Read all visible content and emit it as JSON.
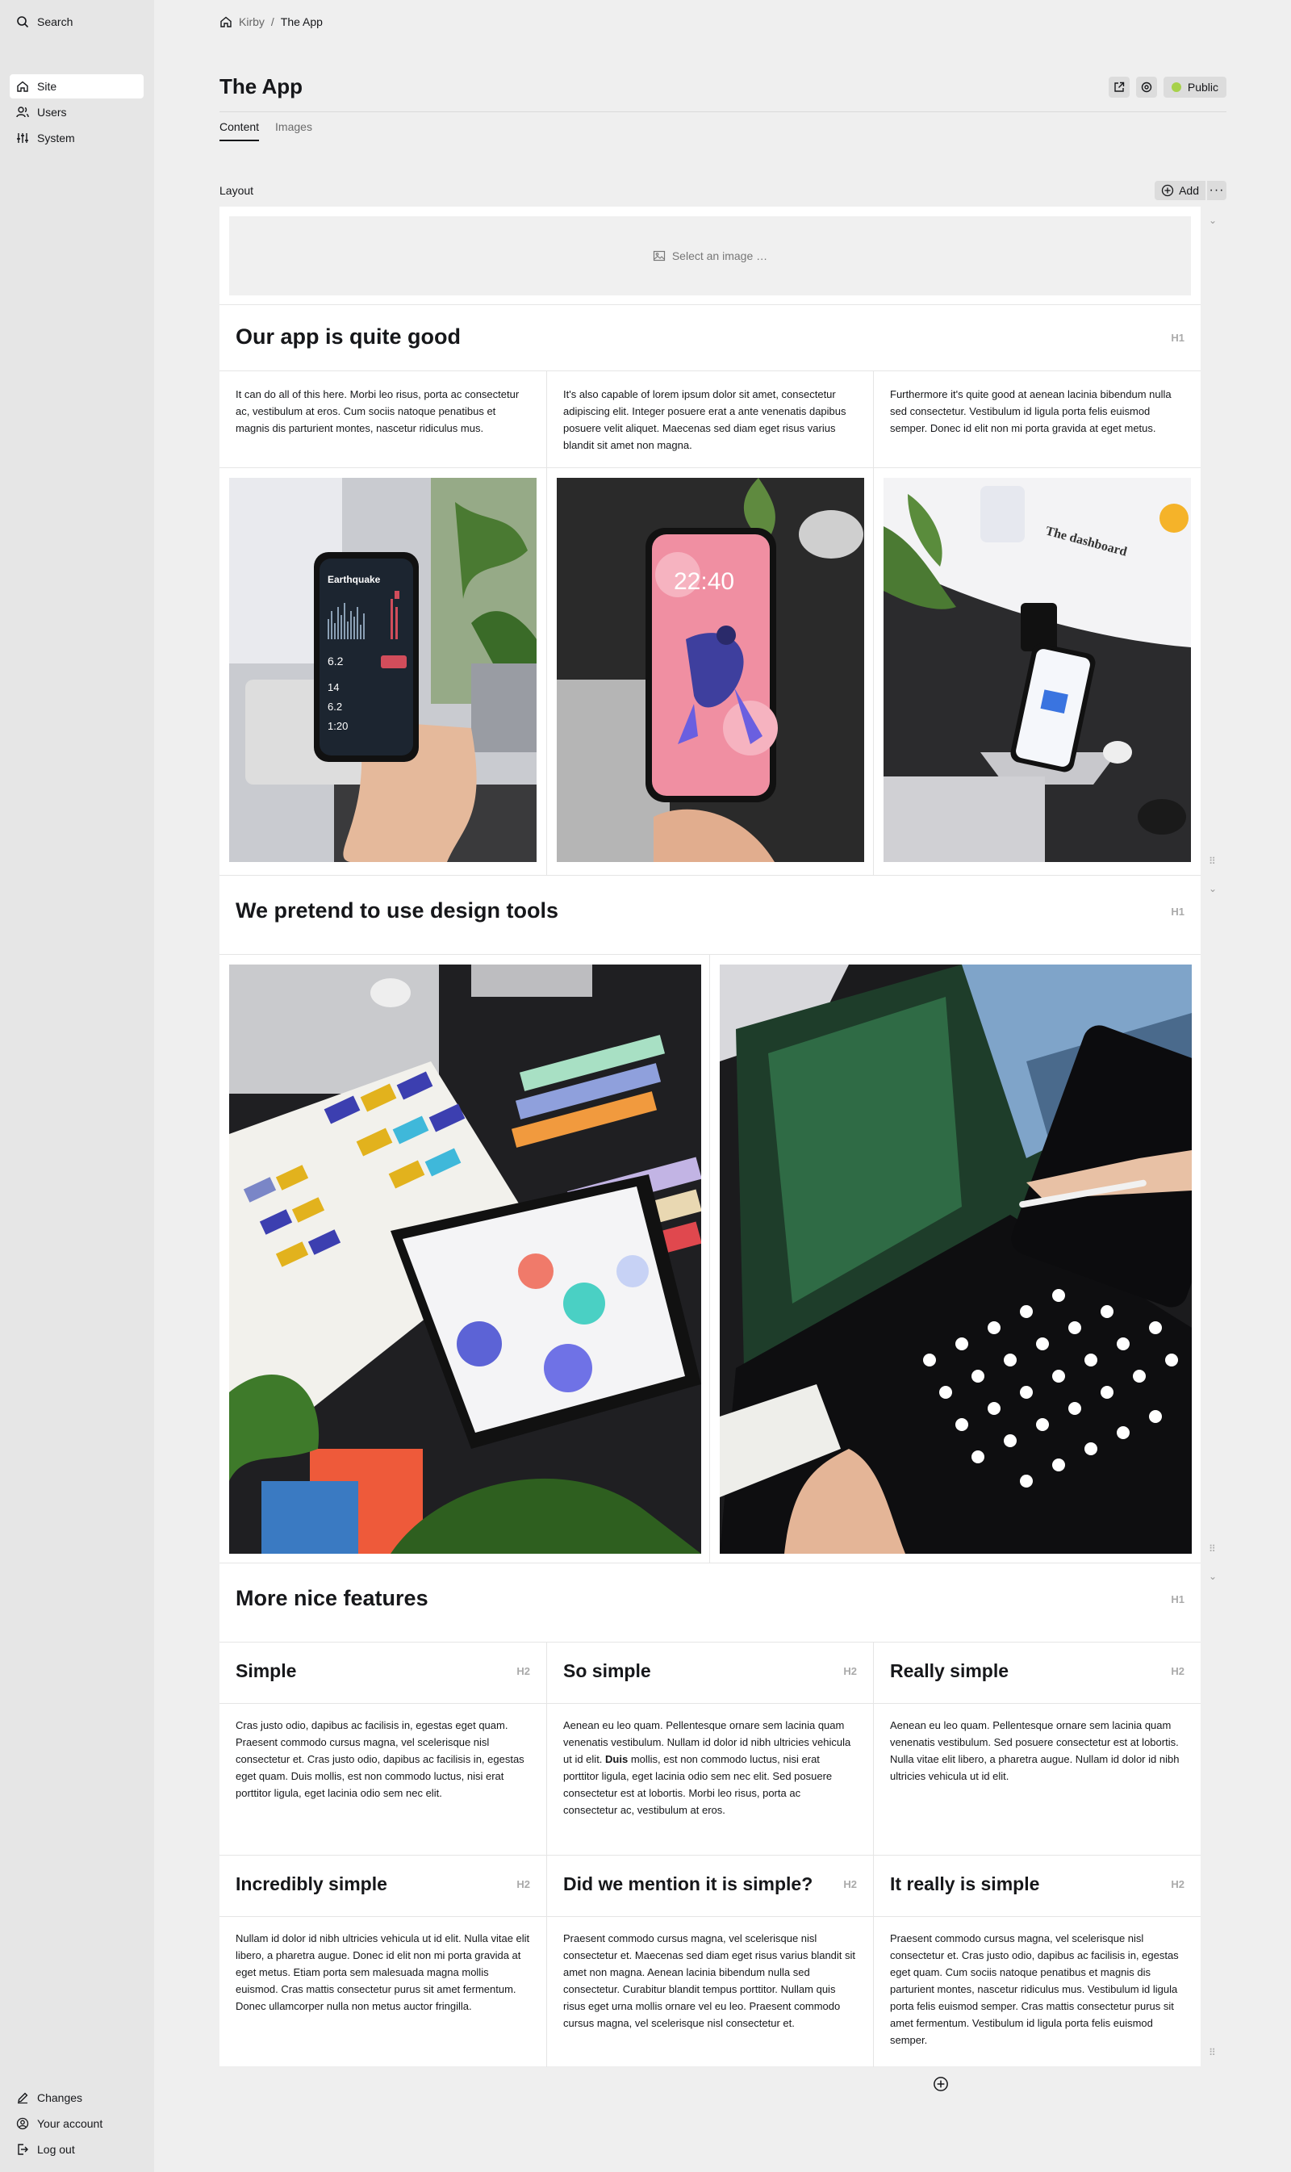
{
  "sidebar": {
    "search": "Search",
    "items": [
      {
        "label": "Site",
        "icon": "home-icon",
        "active": true
      },
      {
        "label": "Users",
        "icon": "users-icon"
      },
      {
        "label": "System",
        "icon": "settings-sliders-icon"
      }
    ],
    "bottom": [
      {
        "label": "Changes",
        "icon": "pencil-icon"
      },
      {
        "label": "Your account",
        "icon": "account-icon"
      },
      {
        "label": "Log out",
        "icon": "logout-icon"
      }
    ]
  },
  "breadcrumb": {
    "root": "Kirby",
    "current": "The App"
  },
  "page": {
    "title": "The App",
    "status": "Public",
    "status_color": "#a7d14a"
  },
  "tabs": [
    "Content",
    "Images"
  ],
  "layout_field": {
    "label": "Layout",
    "add": "Add",
    "placeholder": "Select an image …"
  },
  "blocks": {
    "row1": {
      "heading": "Our app is quite good",
      "heading_tag": "H1",
      "texts": [
        "It can do all of this here. Morbi leo risus, porta ac consectetur ac, vestibulum at eros. Cum sociis natoque penatibus et magnis dis parturient montes, nascetur ridiculus mus.",
        "It's also capable of lorem ipsum dolor sit amet, consectetur adipiscing elit. Integer posuere erat a ante venenatis dapibus posuere velit aliquet. Maecenas sed diam eget risus varius blandit sit amet non magna.",
        "Furthermore it's quite good at aenean lacinia bibendum nulla sed consectetur. Vestibulum id ligula porta felis euismod semper. Donec id elit non mi porta gravida at eget metus."
      ],
      "phone1": {
        "app": "Earthquake",
        "v1": "6.2",
        "v2": "14",
        "v3": "6.2",
        "v4": "1:20"
      },
      "phone2": {
        "time": "22:40"
      },
      "phone3": {
        "title": "The dashboard"
      }
    },
    "row2": {
      "heading": "We pretend to use design tools",
      "heading_tag": "H1"
    },
    "row3": {
      "heading": "More nice features",
      "heading_tag": "H1",
      "cards": [
        {
          "title": "Simple",
          "tag": "H2",
          "text": "Cras justo odio, dapibus ac facilisis in, egestas eget quam. Praesent commodo cursus magna, vel scelerisque nisl consectetur et. Cras justo odio, dapibus ac facilisis in, egestas eget quam. Duis mollis, est non commodo luctus, nisi erat porttitor ligula, eget lacinia odio sem nec elit."
        },
        {
          "title": "So simple",
          "tag": "H2",
          "text_before": "Aenean eu leo quam. Pellentesque ornare sem lacinia quam venenatis vestibulum. Nullam id dolor id nibh ultricies vehicula ut id elit. ",
          "text_bold": "Duis",
          "text_after": " mollis, est non commodo luctus, nisi erat porttitor ligula, eget lacinia odio sem nec elit. Sed posuere consectetur est at lobortis. Morbi leo risus, porta ac consectetur ac, vestibulum at eros."
        },
        {
          "title": "Really simple",
          "tag": "H2",
          "text": "Aenean eu leo quam. Pellentesque ornare sem lacinia quam venenatis vestibulum. Sed posuere consectetur est at lobortis. Nulla vitae elit libero, a pharetra augue. Nullam id dolor id nibh ultricies vehicula ut id elit."
        },
        {
          "title": "Incredibly simple",
          "tag": "H2",
          "text": "Nullam id dolor id nibh ultricies vehicula ut id elit. Nulla vitae elit libero, a pharetra augue. Donec id elit non mi porta gravida at eget metus. Etiam porta sem malesuada magna mollis euismod. Cras mattis consectetur purus sit amet fermentum. Donec ullamcorper nulla non metus auctor fringilla."
        },
        {
          "title": "Did we mention it is simple?",
          "tag": "H2",
          "text": "Praesent commodo cursus magna, vel scelerisque nisl consectetur et. Maecenas sed diam eget risus varius blandit sit amet non magna. Aenean lacinia bibendum nulla sed consectetur. Curabitur blandit tempus porttitor. Nullam quis risus eget urna mollis ornare vel eu leo. Praesent commodo cursus magna, vel scelerisque nisl consectetur et."
        },
        {
          "title": "It really is simple",
          "tag": "H2",
          "text": "Praesent commodo cursus magna, vel scelerisque nisl consectetur et. Cras justo odio, dapibus ac facilisis in, egestas eget quam. Cum sociis natoque penatibus et magnis dis parturient montes, nascetur ridiculus mus. Vestibulum id ligula porta felis euismod semper. Cras mattis consectetur purus sit amet fermentum. Vestibulum id ligula porta felis euismod semper."
        }
      ]
    }
  }
}
